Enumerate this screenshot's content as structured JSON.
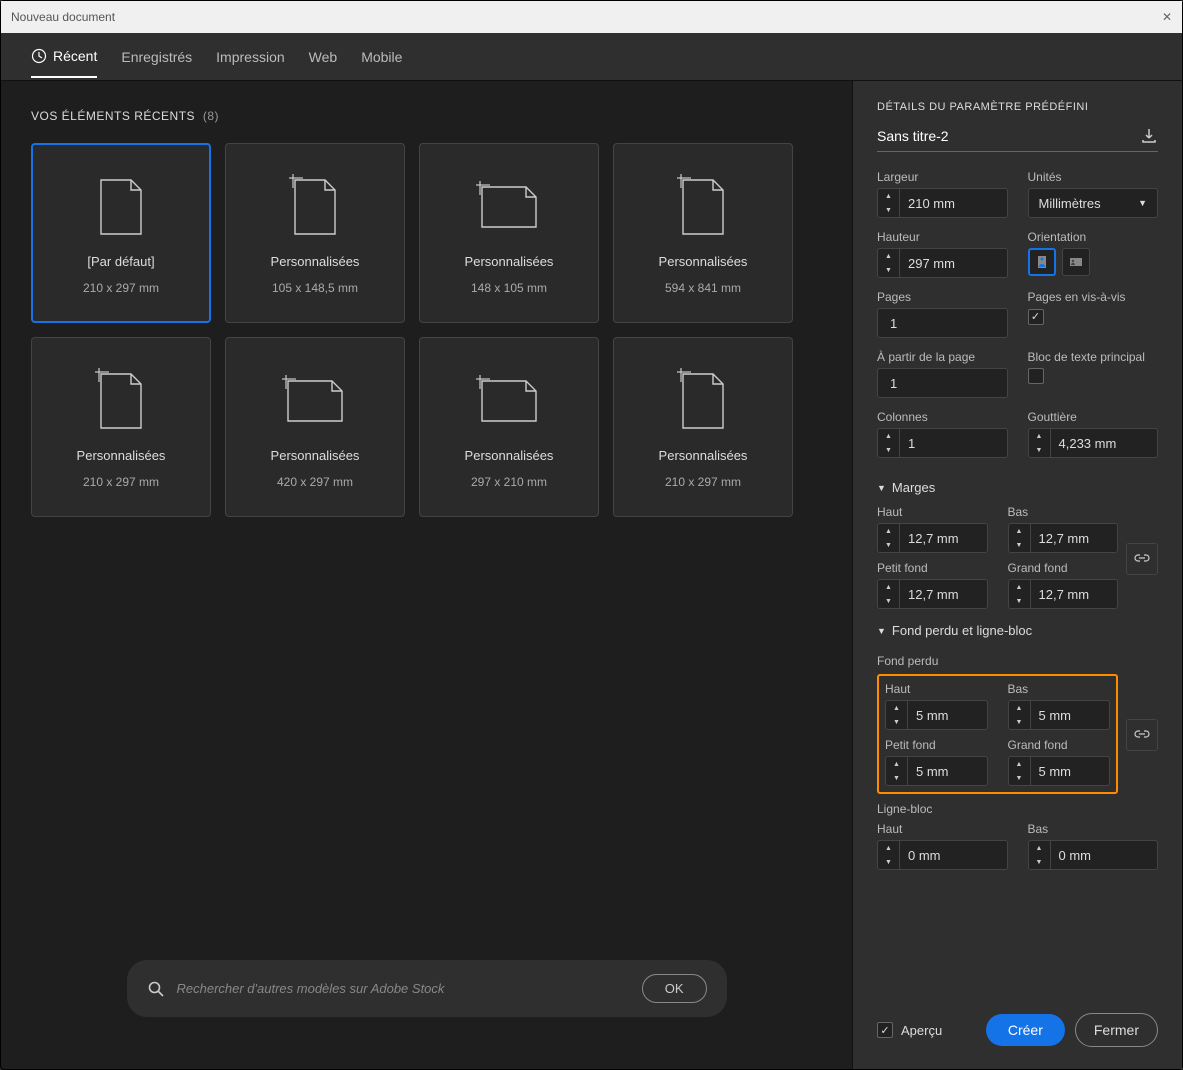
{
  "window_title": "Nouveau document",
  "tabs": {
    "recent": "Récent",
    "saved": "Enregistrés",
    "print": "Impression",
    "web": "Web",
    "mobile": "Mobile"
  },
  "recents": {
    "heading": "VOS ÉLÉMENTS RÉCENTS",
    "count": "(8)",
    "items": [
      {
        "name": "[Par défaut]",
        "dims": "210 x 297 mm",
        "selected": true,
        "orient": "portrait"
      },
      {
        "name": "Personnalisées",
        "dims": "105 x 148,5 mm",
        "orient": "portrait"
      },
      {
        "name": "Personnalisées",
        "dims": "148 x 105 mm",
        "orient": "landscape"
      },
      {
        "name": "Personnalisées",
        "dims": "594 x 841 mm",
        "orient": "portrait"
      },
      {
        "name": "Personnalisées",
        "dims": "210 x 297 mm",
        "orient": "portrait"
      },
      {
        "name": "Personnalisées",
        "dims": "420 x 297 mm",
        "orient": "landscape"
      },
      {
        "name": "Personnalisées",
        "dims": "297 x 210 mm",
        "orient": "landscape"
      },
      {
        "name": "Personnalisées",
        "dims": "210 x 297 mm",
        "orient": "portrait"
      }
    ]
  },
  "search": {
    "placeholder": "Rechercher d'autres modèles sur Adobe Stock",
    "ok_label": "OK"
  },
  "details": {
    "heading": "DÉTAILS DU PARAMÈTRE PRÉDÉFINI",
    "doc_name": "Sans titre-2",
    "width_label": "Largeur",
    "width_value": "210 mm",
    "units_label": "Unités",
    "units_value": "Millimètres",
    "height_label": "Hauteur",
    "height_value": "297 mm",
    "orientation_label": "Orientation",
    "pages_label": "Pages",
    "pages_value": "1",
    "facing_label": "Pages en vis-à-vis",
    "facing_checked": true,
    "start_label": "À partir de la page",
    "start_value": "1",
    "primary_frame_label": "Bloc de texte principal",
    "primary_frame_checked": false,
    "columns_label": "Colonnes",
    "columns_value": "1",
    "gutter_label": "Gouttière",
    "gutter_value": "4,233 mm",
    "margins_heading": "Marges",
    "margin_top_label": "Haut",
    "margin_top_value": "12,7 mm",
    "margin_bottom_label": "Bas",
    "margin_bottom_value": "12,7 mm",
    "margin_inside_label": "Petit fond",
    "margin_inside_value": "12,7 mm",
    "margin_outside_label": "Grand fond",
    "margin_outside_value": "12,7 mm",
    "bleed_heading": "Fond perdu et ligne-bloc",
    "bleed_label": "Fond perdu",
    "bleed_top_label": "Haut",
    "bleed_top_value": "5 mm",
    "bleed_bottom_label": "Bas",
    "bleed_bottom_value": "5 mm",
    "bleed_inside_label": "Petit fond",
    "bleed_inside_value": "5 mm",
    "bleed_outside_label": "Grand fond",
    "bleed_outside_value": "5 mm",
    "slug_label": "Ligne-bloc",
    "slug_top_label": "Haut",
    "slug_top_value": "0 mm",
    "slug_bottom_label": "Bas",
    "slug_bottom_value": "0 mm",
    "preview_label": "Aperçu",
    "create_label": "Créer",
    "close_label": "Fermer"
  }
}
